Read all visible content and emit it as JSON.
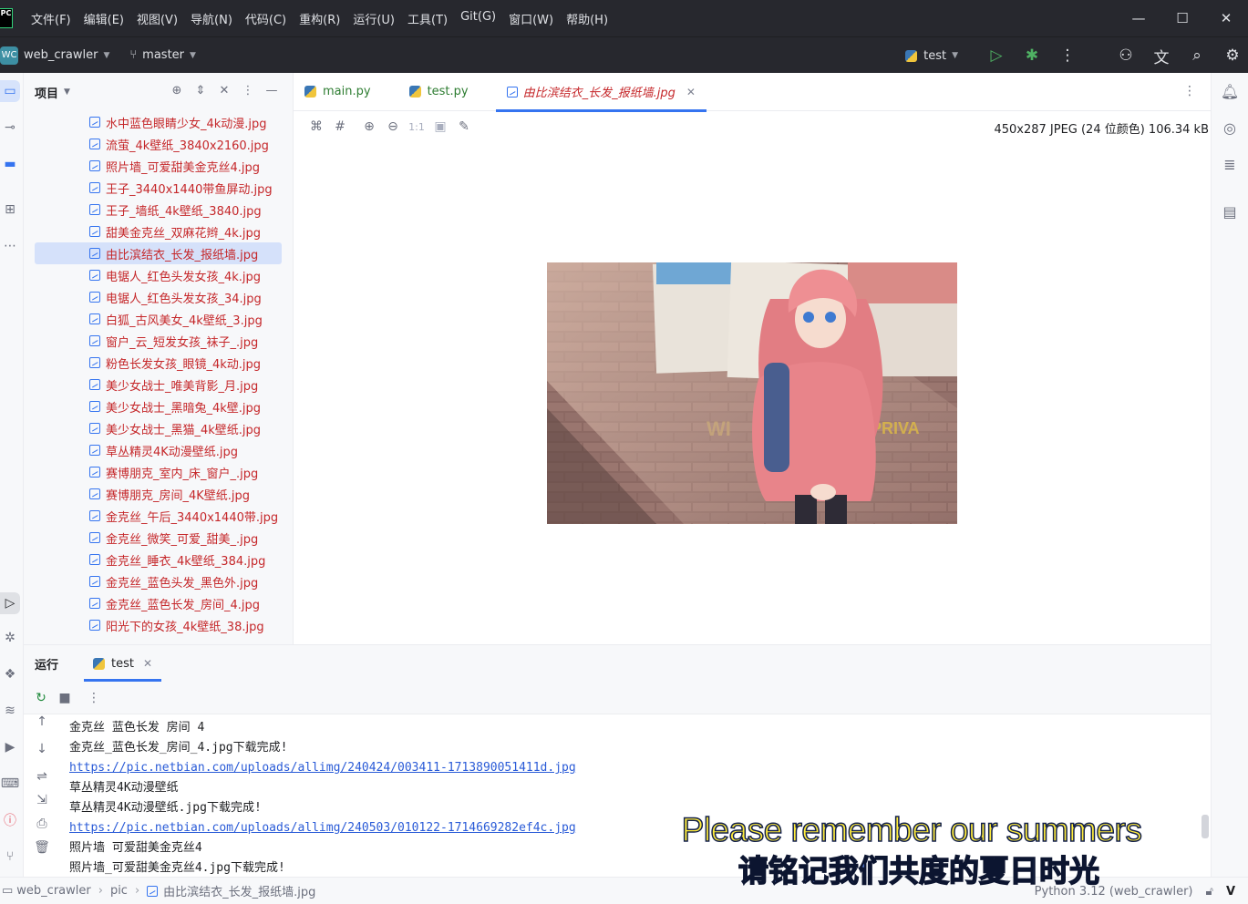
{
  "menu": [
    "文件(F)",
    "编辑(E)",
    "视图(V)",
    "导航(N)",
    "代码(C)",
    "重构(R)",
    "运行(U)",
    "工具(T)",
    "Git(G)",
    "窗口(W)",
    "帮助(H)"
  ],
  "app_logo": "PC",
  "toolbar": {
    "project_badge": "WC",
    "project_name": "web_crawler",
    "branch": "master",
    "run_config": "test"
  },
  "project_panel": {
    "title": "项目",
    "files": [
      "水中蓝色眼睛少女_4k动漫.jpg",
      "流萤_4k壁纸_3840x2160.jpg",
      "照片墙_可爱甜美金克丝4.jpg",
      "王子_3440x1440带鱼屏动.jpg",
      "王子_墙纸_4k壁纸_3840.jpg",
      "甜美金克丝_双麻花辫_4k.jpg",
      "由比滨结衣_长发_报纸墙.jpg",
      "电锯人_红色头发女孩_4k.jpg",
      "电锯人_红色头发女孩_34.jpg",
      "白狐_古风美女_4k壁纸_3.jpg",
      "窗户_云_短发女孩_袜子_.jpg",
      "粉色长发女孩_眼镜_4k动.jpg",
      "美少女战士_唯美背影_月.jpg",
      "美少女战士_黑暗兔_4k壁.jpg",
      "美少女战士_黑猫_4k壁纸.jpg",
      "草丛精灵4K动漫壁纸.jpg",
      "赛博朋克_室内_床_窗户_.jpg",
      "赛博朋克_房间_4K壁纸.jpg",
      "金克丝_午后_3440x1440带.jpg",
      "金克丝_微笑_可爱_甜美_.jpg",
      "金克丝_睡衣_4k壁纸_384.jpg",
      "金克丝_蓝色头发_黑色外.jpg",
      "金克丝_蓝色长发_房间_4.jpg",
      "阳光下的女孩_4k壁纸_38.jpg"
    ],
    "selected_file": "由比滨结衣_长发_报纸墙.jpg"
  },
  "editor": {
    "tabs": [
      {
        "label": "main.py"
      },
      {
        "label": "test.py"
      },
      {
        "label": "由比滨结衣_长发_报纸墙.jpg"
      }
    ],
    "zoom_label": "1:1",
    "image_info": "450x287 JPEG (24 位颜色) 106.34 kB"
  },
  "run_panel": {
    "title": "运行",
    "tab": "test",
    "console": [
      {
        "text": "金克丝 蓝色长发 房间 4",
        "link": false
      },
      {
        "text": "金克丝_蓝色长发_房间_4.jpg下载完成!",
        "link": false
      },
      {
        "text": "https://pic.netbian.com/uploads/allimg/240424/003411-1713890051411d.jpg",
        "link": true
      },
      {
        "text": "草丛精灵4K动漫壁纸",
        "link": false
      },
      {
        "text": "草丛精灵4K动漫壁纸.jpg下载完成!",
        "link": false
      },
      {
        "text": "https://pic.netbian.com/uploads/allimg/240503/010122-1714669282ef4c.jpg",
        "link": true
      },
      {
        "text": "照片墙 可爱甜美金克丝4",
        "link": false
      },
      {
        "text": "照片墙_可爱甜美金克丝4.jpg下载完成!",
        "link": false
      }
    ]
  },
  "subtitle": {
    "en": "Please remember our summers",
    "zh": "请铭记我们共度的夏日时光"
  },
  "statusbar": {
    "crumbs": [
      "web_crawler",
      "pic",
      "由比滨结衣_长发_报纸墙.jpg"
    ],
    "interpreter": "Python 3.12 (web_crawler)"
  },
  "colors": {
    "accent": "#3574f0",
    "title_bg": "#27282e",
    "file_red": "#c5272a",
    "link": "#2a5bd7"
  }
}
